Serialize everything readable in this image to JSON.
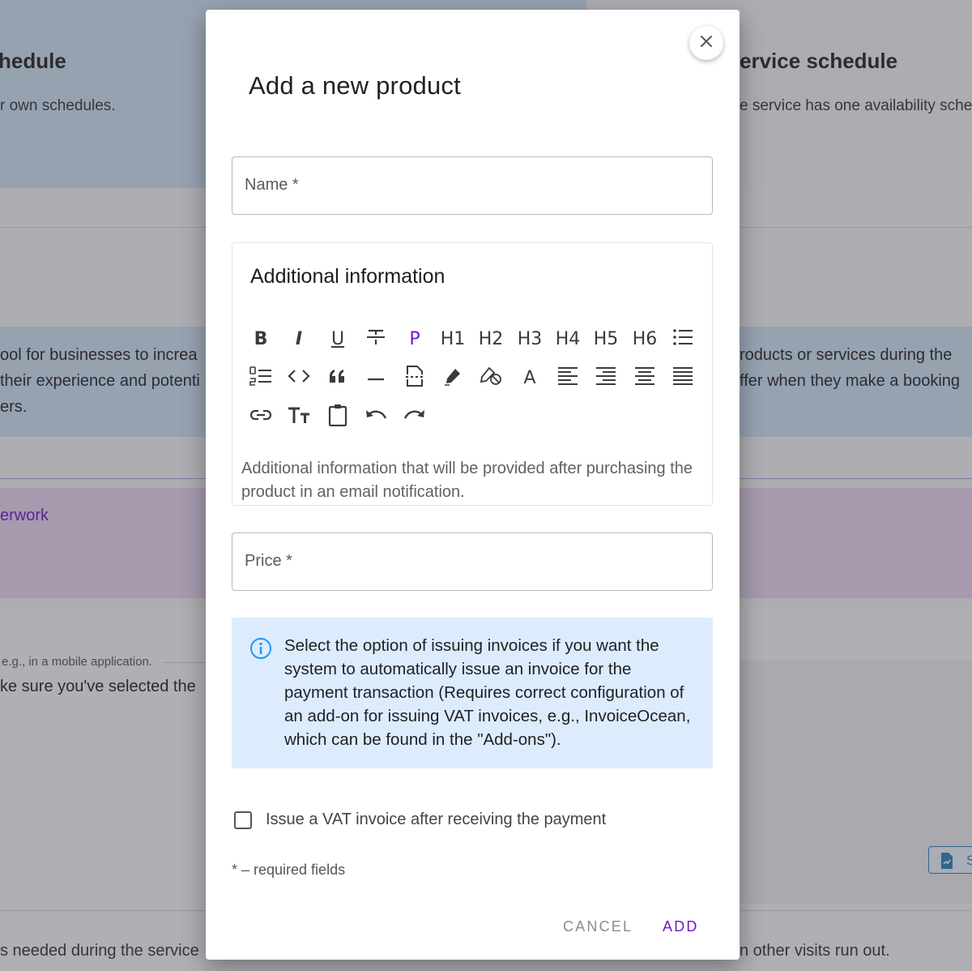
{
  "background": {
    "left_title": "hedule",
    "left_subtitle": "r own schedules.",
    "right_title": "ervice schedule",
    "right_subtitle": "e service has one availability sched",
    "left_blue_line1": "ool for businesses to increa",
    "left_blue_line2": "their experience and potenti",
    "left_blue_line3": "ers.",
    "right_blue_line1": "roducts or services during the",
    "right_blue_line2": "ffer when they make a booking",
    "left_purple": "erwork",
    "left_small": "e.g., in a mobile application.",
    "left_mid": "ke sure you've selected the",
    "left_bottom": "s needed during the service",
    "right_bottom": "n other visits run out.",
    "right_button_label": "S"
  },
  "modal": {
    "title": "Add a new product",
    "close_icon": "close-icon",
    "name_label": "Name *",
    "editor": {
      "title": "Additional information",
      "placeholder": "Additional information that will be provided after purchasing the product in an email notification.",
      "toolbar": {
        "bold": "B",
        "italic": "I",
        "underline": "U",
        "paragraph": "P",
        "h1": "H1",
        "h2": "H2",
        "h3": "H3",
        "h4": "H4",
        "h5": "H5",
        "h6": "H6",
        "font_color": "A",
        "paragraph_color": "#6a1bc9"
      }
    },
    "price_label": "Price *",
    "info_text": "Select the option of issuing invoices if you want the system to automatically issue an invoice for the payment transaction (Requires correct configuration of an add-on for issuing VAT invoices, e.g., InvoiceOcean, which can be found in the \"Add-ons\").",
    "checkbox_label": "Issue a VAT invoice after receiving the payment",
    "checkbox_checked": false,
    "required_note": "* – required fields",
    "cancel_label": "CANCEL",
    "add_label": "ADD",
    "colors": {
      "accent": "#6a1bc9",
      "info_bg": "#dcecfd",
      "info_icon": "#2196f3"
    }
  }
}
